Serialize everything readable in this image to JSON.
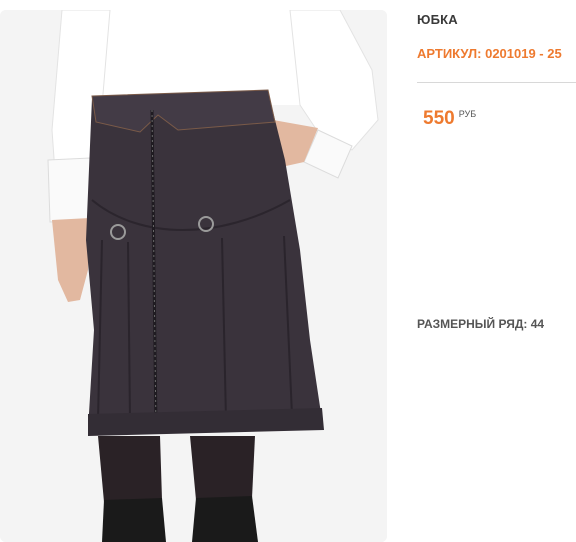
{
  "product": {
    "title": "ЮБКА",
    "article": "АРТИКУЛ: 0201019 - 25",
    "price": {
      "value": "550",
      "currency": "РУБ"
    },
    "size_range": "РАЗМЕРНЫЙ РЯД: 44"
  },
  "colors": {
    "accent": "#ee7a2f",
    "skirt": "#3a333c",
    "shirt": "#ffffff",
    "skin": "#e2b8a0",
    "boots": "#1a1a1a",
    "photo_bg": "#f2f2f2"
  }
}
